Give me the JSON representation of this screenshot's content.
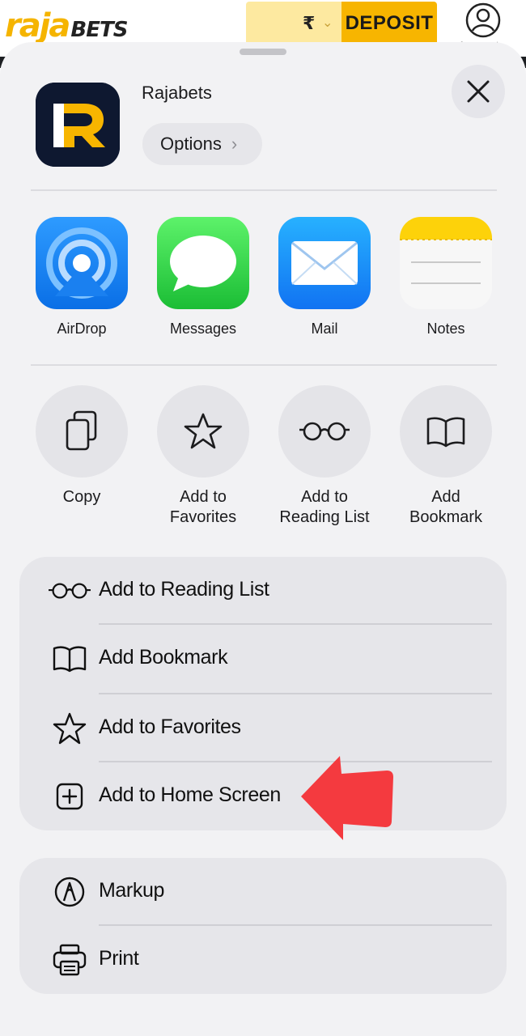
{
  "website": {
    "logo_primary": "raja",
    "logo_secondary": "BETS",
    "currency_symbol": "₹",
    "deposit_label": "DEPOSIT",
    "account_label": "Account",
    "brand_colors": {
      "yellow": "#f7b500",
      "pale_yellow": "#fde9a0",
      "dark": "#1d1f22"
    }
  },
  "share_sheet": {
    "app_name": "Rajabets",
    "app_icon_letter": "R",
    "options_label": "Options",
    "close_icon": "close-icon",
    "apps": [
      {
        "label": "AirDrop",
        "icon": "airdrop-icon"
      },
      {
        "label": "Messages",
        "icon": "messages-icon"
      },
      {
        "label": "Mail",
        "icon": "mail-icon"
      },
      {
        "label": "Notes",
        "icon": "notes-icon"
      }
    ],
    "quick_actions": [
      {
        "line1": "Copy",
        "line2": "",
        "icon": "copy-icon"
      },
      {
        "line1": "Add to",
        "line2": "Favorites",
        "icon": "star-icon"
      },
      {
        "line1": "Add to",
        "line2": "Reading List",
        "icon": "glasses-icon"
      },
      {
        "line1": "Add",
        "line2": "Bookmark",
        "icon": "book-icon"
      }
    ],
    "menu_group_1": [
      {
        "label": "Add to Reading List",
        "icon": "glasses-icon"
      },
      {
        "label": "Add Bookmark",
        "icon": "book-icon"
      },
      {
        "label": "Add to Favorites",
        "icon": "star-icon"
      },
      {
        "label": "Add to Home Screen",
        "icon": "plus-square-icon"
      }
    ],
    "menu_group_2": [
      {
        "label": "Markup",
        "icon": "markup-icon"
      },
      {
        "label": "Print",
        "icon": "printer-icon"
      }
    ],
    "annotation": {
      "icon": "red-arrow-icon",
      "color": "#f43a3f",
      "points_to": "Add to Home Screen"
    }
  }
}
